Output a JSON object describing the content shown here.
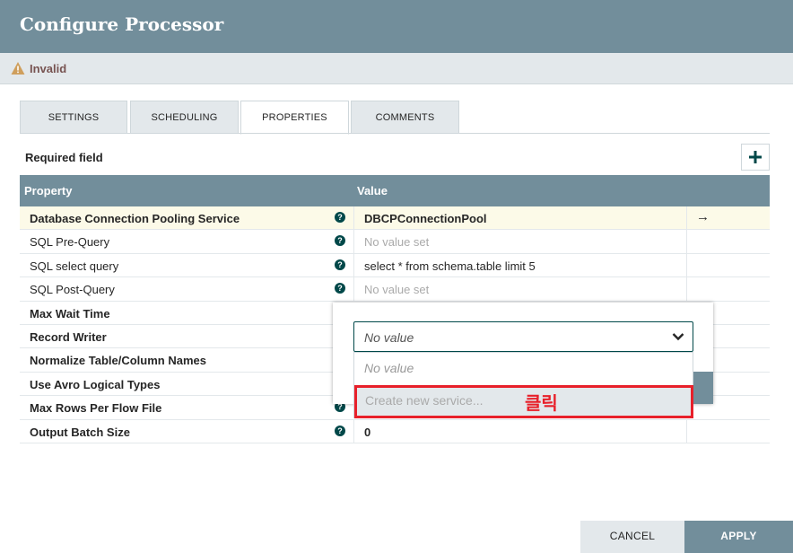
{
  "dialog": {
    "title": "Configure Processor"
  },
  "status": {
    "label": "Invalid",
    "icon": "warning-icon"
  },
  "tabs": [
    {
      "label": "SETTINGS"
    },
    {
      "label": "SCHEDULING"
    },
    {
      "label": "PROPERTIES",
      "active": true
    },
    {
      "label": "COMMENTS"
    }
  ],
  "properties": {
    "required_label": "Required field",
    "add_icon": "plus-icon",
    "columns": {
      "property": "Property",
      "value": "Value"
    },
    "rows": [
      {
        "name": "Database Connection Pooling Service",
        "value": "DBCPConnectionPool",
        "required": true
      },
      {
        "name": "SQL Pre-Query",
        "value": "No value set",
        "required": false
      },
      {
        "name": "SQL select query",
        "value": "select * from schema.table limit 5",
        "required": false
      },
      {
        "name": "SQL Post-Query",
        "value": "No value set",
        "required": false
      },
      {
        "name": "Max Wait Time",
        "value": "",
        "required": true
      },
      {
        "name": "Record Writer",
        "value": "",
        "required": true
      },
      {
        "name": "Normalize Table/Column Names",
        "value": "",
        "required": true
      },
      {
        "name": "Use Avro Logical Types",
        "value": "",
        "required": true
      },
      {
        "name": "Max Rows Per Flow File",
        "value": "",
        "required": true
      },
      {
        "name": "Output Batch Size",
        "value": "0",
        "required": true
      }
    ]
  },
  "editor": {
    "selected": "No value",
    "options": [
      "No value",
      "Create new service..."
    ],
    "annotation": "클릭"
  },
  "footer": {
    "cancel_label": "CANCEL",
    "apply_label": "APPLY"
  },
  "colors": {
    "header": "#728e9b",
    "accent": "#004849",
    "highlight_row": "#fcfae8",
    "annotation": "#e8202a"
  }
}
